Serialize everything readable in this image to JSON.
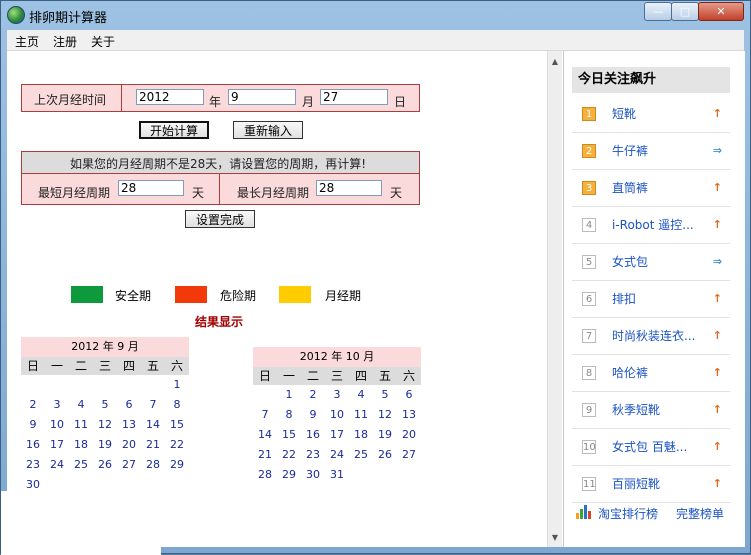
{
  "window": {
    "title": "排卵期计算器"
  },
  "menu": [
    "主页",
    "注册",
    "关于"
  ],
  "last_period": {
    "label": "上次月经时间",
    "year": "2012",
    "year_unit": "年",
    "month": "9",
    "month_unit": "月",
    "day": "27",
    "day_unit": "日"
  },
  "buttons": {
    "calculate": "开始计算",
    "reset": "重新输入",
    "done": "设置完成"
  },
  "cycle": {
    "notice": "如果您的月经周期不是28天，请设置您的周期，再计算!",
    "shortest_label": "最短月经周期",
    "shortest_value": "28",
    "shortest_unit": "天",
    "longest_label": "最长月经周期",
    "longest_value": "28",
    "longest_unit": "天"
  },
  "legend": [
    {
      "label": "安全期",
      "color": "#0e9a3c"
    },
    {
      "label": "危险期",
      "color": "#f2390a"
    },
    {
      "label": "月经期",
      "color": "#ffcc00"
    }
  ],
  "result_title": "结果显示",
  "weekdays": [
    "日",
    "一",
    "二",
    "三",
    "四",
    "五",
    "六"
  ],
  "calendars": [
    {
      "header": "2012 年 9 月",
      "offset": 6,
      "days": 30
    },
    {
      "header": "2012 年 10 月",
      "offset": 1,
      "days": 31
    }
  ],
  "sidebar": {
    "title": "今日关注飙升",
    "items": [
      {
        "rank": "1",
        "label": "短靴",
        "trend": "up"
      },
      {
        "rank": "2",
        "label": "牛仔裤",
        "trend": "flat"
      },
      {
        "rank": "3",
        "label": "直筒裤",
        "trend": "up"
      },
      {
        "rank": "4",
        "label": "i-Robot 遥控...",
        "trend": "up"
      },
      {
        "rank": "5",
        "label": "女式包",
        "trend": "flat"
      },
      {
        "rank": "6",
        "label": "排扣",
        "trend": "up"
      },
      {
        "rank": "7",
        "label": "时尚秋装连衣...",
        "trend": "up"
      },
      {
        "rank": "8",
        "label": "哈伦裤",
        "trend": "up"
      },
      {
        "rank": "9",
        "label": "秋季短靴",
        "trend": "up"
      },
      {
        "rank": "10",
        "label": "女式包 百魅...",
        "trend": "up"
      },
      {
        "rank": "11",
        "label": "百丽短靴",
        "trend": "up"
      }
    ],
    "footer_link1": "淘宝排行榜",
    "footer_link2": "完整榜单"
  },
  "colors": {
    "table_bg": "#fadada",
    "calendar_day": "#1a2a9a",
    "link": "#1a52c3"
  }
}
